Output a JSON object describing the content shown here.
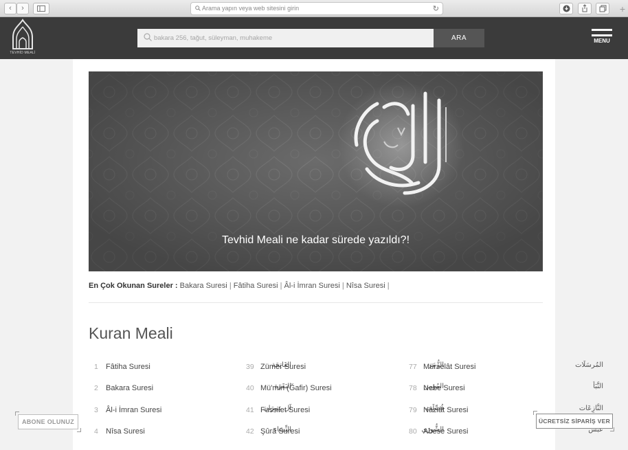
{
  "browser": {
    "address_placeholder": "Arama yapın veya web sitesini girin",
    "back_glyph": "‹",
    "forward_glyph": "›",
    "new_tab_glyph": "+"
  },
  "header": {
    "logo_text": "TEVHİD MEALİ",
    "search_placeholder": "bakara 256, tağut, süleyman, muhakeme",
    "search_button": "ARA",
    "menu_label": "MENU"
  },
  "banner": {
    "caption": "Tevhid Meali ne kadar sürede yazıldı?!"
  },
  "popular": {
    "label": "En Çok Okunan Sureler :",
    "items": [
      "Bakara Suresi",
      "Fâtiha Suresi",
      "Âl-i İmran Suresi",
      "Nîsa Suresi"
    ],
    "separator": "|"
  },
  "kuran": {
    "title": "Kuran Meali",
    "columns": [
      [
        {
          "num": "1",
          "name": "Fâtiha Suresi",
          "arabic": "الفَاتِحَة"
        },
        {
          "num": "2",
          "name": "Bakara Suresi",
          "arabic": "البَقَرَة"
        },
        {
          "num": "3",
          "name": "Âl-i İmran Suresi",
          "arabic": "آل عِمرَان"
        },
        {
          "num": "4",
          "name": "Nîsa Suresi",
          "arabic": "النِّسَاء"
        }
      ],
      [
        {
          "num": "39",
          "name": "Zümer Suresi",
          "arabic": "الزُّمَر"
        },
        {
          "num": "40",
          "name": "Mü'min (Ğafir) Suresi",
          "arabic": "المُؤمِن"
        },
        {
          "num": "41",
          "name": "Fussilet Suresi",
          "arabic": "فُصِّلَت"
        },
        {
          "num": "42",
          "name": "Şûrâ Suresi",
          "arabic": "الشُّورَى"
        }
      ],
      [
        {
          "num": "77",
          "name": "Mürselât Suresi",
          "arabic": "المُرسَلَات"
        },
        {
          "num": "78",
          "name": "Nebe Suresi",
          "arabic": "النَّبَأ"
        },
        {
          "num": "79",
          "name": "Nâziât Suresi",
          "arabic": "النَّازِعَات"
        },
        {
          "num": "80",
          "name": "Abese Suresi",
          "arabic": "عَبَسَ"
        }
      ]
    ]
  },
  "widgets": {
    "subscribe": "ABONE OLUNUZ",
    "order": "ÜCRETSİZ SİPARİŞ VER"
  },
  "colors": {
    "header_bg": "#3b3b3b",
    "banner_bg": "#6b6b6b",
    "search_button_bg": "#555555"
  }
}
